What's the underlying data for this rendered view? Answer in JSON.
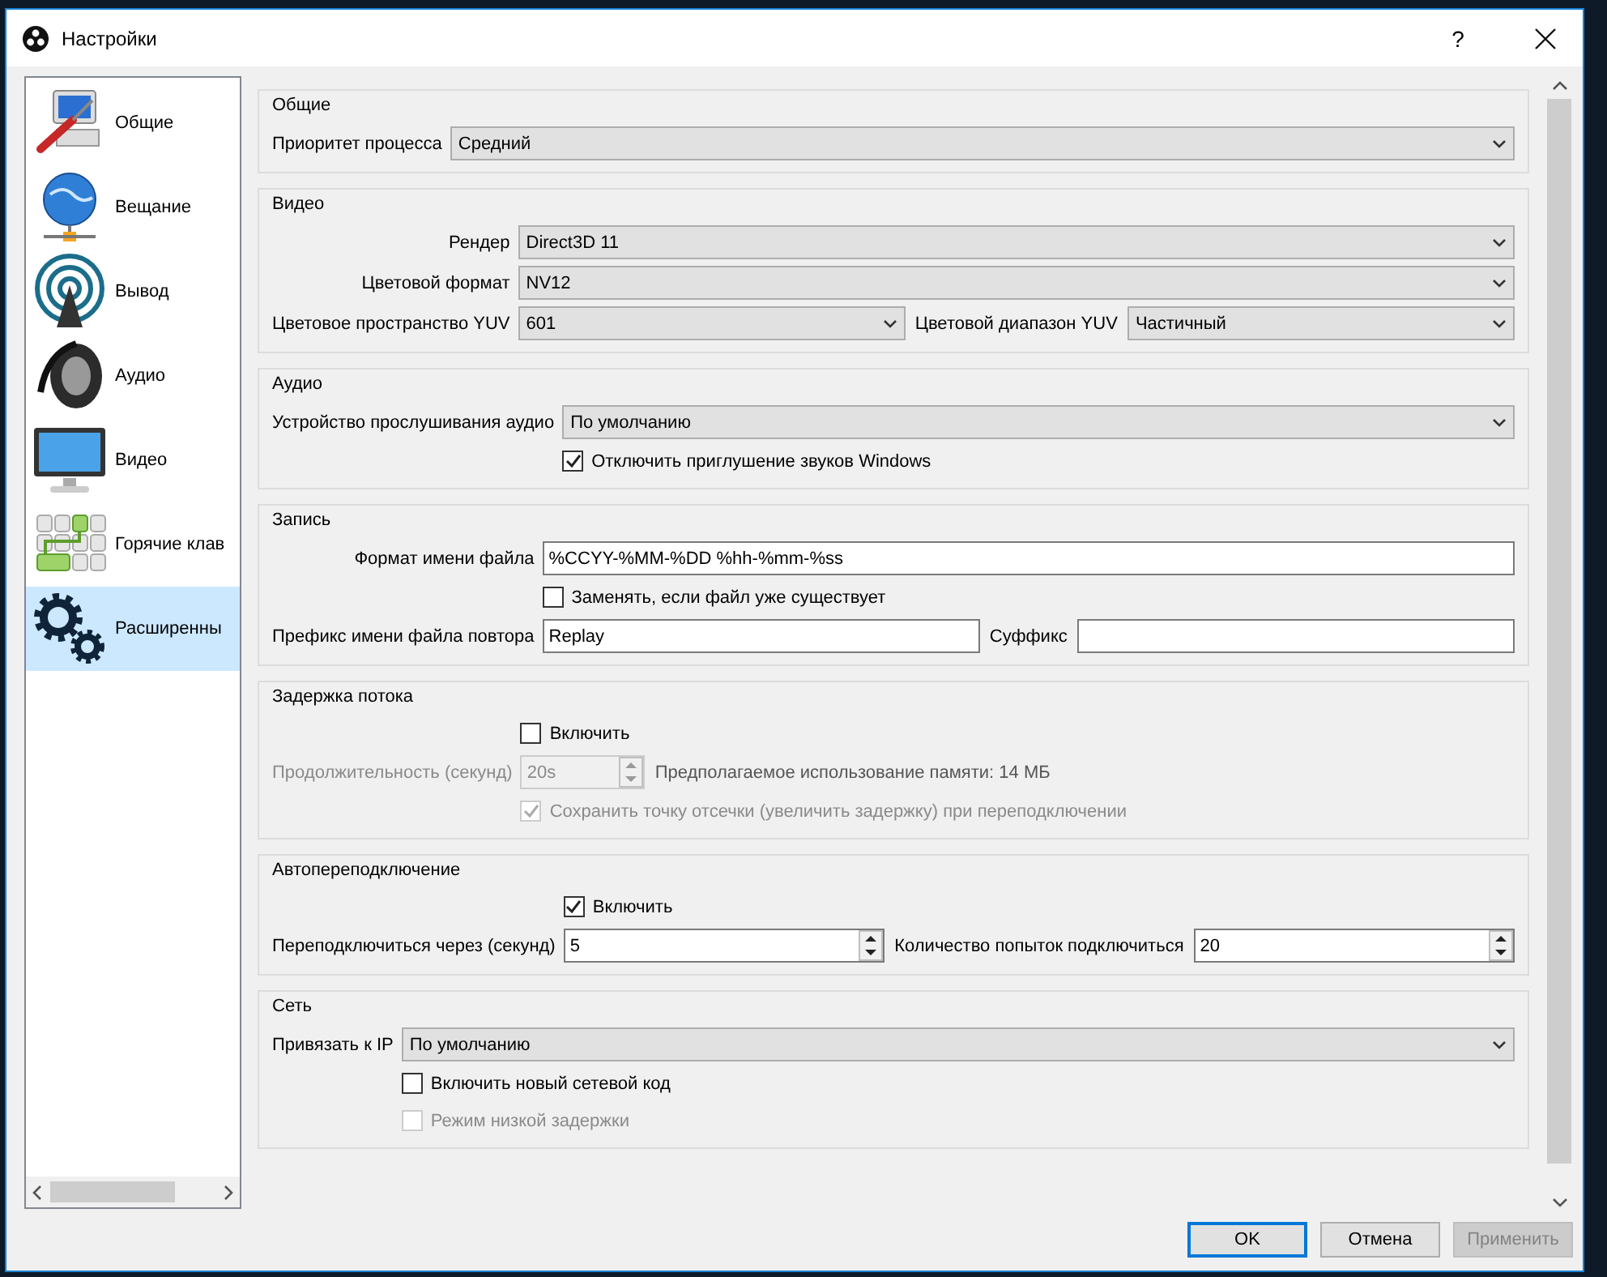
{
  "window": {
    "title": "Настройки",
    "help": "?"
  },
  "sidebar": {
    "items": [
      {
        "label": "Общие",
        "kind": "general",
        "selected": false
      },
      {
        "label": "Вещание",
        "kind": "stream",
        "selected": false
      },
      {
        "label": "Вывод",
        "kind": "output",
        "selected": false
      },
      {
        "label": "Аудио",
        "kind": "audio",
        "selected": false
      },
      {
        "label": "Видео",
        "kind": "video",
        "selected": false
      },
      {
        "label": "Горячие клав",
        "kind": "hotkeys",
        "selected": false
      },
      {
        "label": "Расширенны",
        "kind": "advanced",
        "selected": true
      }
    ]
  },
  "sections": [
    {
      "title": "Общие",
      "rows": [
        {
          "label": "Приоритет процесса",
          "disabled": false,
          "controls": [
            {
              "kind": "select",
              "value": "Средний"
            }
          ]
        }
      ]
    },
    {
      "title": "Видео",
      "rows": [
        {
          "label": "Рендер",
          "disabled": false,
          "controls": [
            {
              "kind": "select",
              "value": "Direct3D 11"
            }
          ]
        },
        {
          "label": "Цветовой формат",
          "disabled": false,
          "controls": [
            {
              "kind": "select",
              "value": "NV12"
            }
          ]
        },
        {
          "label": "Цветовое пространство YUV",
          "disabled": false,
          "controls": [
            {
              "kind": "select",
              "value": "601"
            },
            {
              "kind": "label",
              "text": "Цветовой диапазон YUV"
            },
            {
              "kind": "select",
              "value": "Частичный"
            }
          ]
        }
      ]
    },
    {
      "title": "Аудио",
      "rows": [
        {
          "label": "Устройство прослушивания аудио",
          "disabled": false,
          "controls": [
            {
              "kind": "select",
              "value": "По умолчанию"
            }
          ]
        },
        {
          "controls": [
            {
              "kind": "checkbox",
              "text": "Отключить приглушение звуков Windows",
              "checked": true,
              "disabled": false
            }
          ]
        }
      ]
    },
    {
      "title": "Запись",
      "rows": [
        {
          "label": "Формат имени файла",
          "disabled": false,
          "controls": [
            {
              "kind": "input",
              "value": "%CCYY-%MM-%DD %hh-%mm-%ss"
            }
          ]
        },
        {
          "controls": [
            {
              "kind": "checkbox",
              "text": "Заменять, если файл уже существует",
              "checked": false,
              "disabled": false
            }
          ]
        },
        {
          "label": "Префикс имени файла повтора",
          "disabled": false,
          "controls": [
            {
              "kind": "input",
              "value": "Replay"
            },
            {
              "kind": "label",
              "text": "Суффикс"
            },
            {
              "kind": "input"
            }
          ]
        }
      ]
    },
    {
      "title": "Задержка потока",
      "rows": [
        {
          "controls": [
            {
              "kind": "checkbox",
              "text": "Включить",
              "checked": false,
              "disabled": false
            }
          ]
        },
        {
          "label": "Продолжительность (секунд)",
          "disabled": true,
          "controls": [
            {
              "kind": "spin",
              "value": "20s",
              "disabled": true
            },
            {
              "kind": "note",
              "text": "Предполагаемое использование памяти: 14 МБ"
            }
          ]
        },
        {
          "controls": [
            {
              "kind": "checkbox",
              "text": "Сохранить точку отсечки (увеличить задержку) при переподключении",
              "checked": true,
              "disabled": true
            }
          ]
        }
      ]
    },
    {
      "title": "Автопереподключение",
      "rows": [
        {
          "controls": [
            {
              "kind": "checkbox",
              "text": "Включить",
              "checked": true,
              "disabled": false
            }
          ]
        },
        {
          "label": "Переподключиться через (секунд)",
          "disabled": false,
          "controls": [
            {
              "kind": "spin",
              "value": "5",
              "disabled": false
            },
            {
              "kind": "label",
              "text": "Количество попыток подключиться"
            },
            {
              "kind": "spin",
              "value": "20",
              "disabled": false
            }
          ]
        }
      ]
    },
    {
      "title": "Сеть",
      "rows": [
        {
          "label": "Привязать к IP",
          "disabled": false,
          "controls": [
            {
              "kind": "select",
              "value": "По умолчанию"
            }
          ]
        },
        {
          "controls": [
            {
              "kind": "checkbox",
              "text": "Включить новый сетевой код",
              "checked": false,
              "disabled": false
            }
          ]
        },
        {
          "controls": [
            {
              "kind": "checkbox",
              "text": "Режим низкой задержки",
              "checked": false,
              "disabled": true
            }
          ]
        }
      ]
    }
  ],
  "buttons": [
    {
      "label": "OK",
      "default": true,
      "disabled": false
    },
    {
      "label": "Отмена",
      "default": false,
      "disabled": false
    },
    {
      "label": "Применить",
      "default": false,
      "disabled": true
    }
  ]
}
